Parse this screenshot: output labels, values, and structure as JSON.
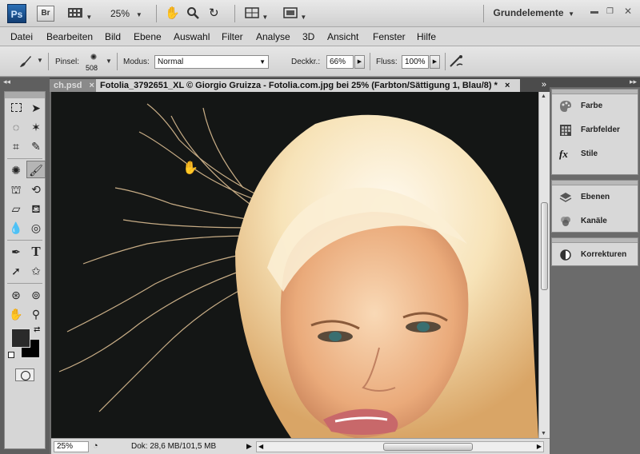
{
  "app": {
    "logo": "Ps",
    "bridge": "Br",
    "zoom": "25%",
    "workspace": "Grundelemente"
  },
  "menu": [
    "Datei",
    "Bearbeiten",
    "Bild",
    "Ebene",
    "Auswahl",
    "Filter",
    "Analyse",
    "3D",
    "Ansicht",
    "Fenster",
    "Hilfe"
  ],
  "options": {
    "brush_label": "Pinsel:",
    "brush_size": "508",
    "mode_label": "Modus:",
    "mode_value": "Normal",
    "opacity_label": "Deckkr.:",
    "opacity_value": "66%",
    "flow_label": "Fluss:",
    "flow_value": "100%"
  },
  "tabs": {
    "inactive": "ch.psd",
    "inactive_close": "×",
    "active": "Fotolia_3792651_XL © Giorgio Gruizza - Fotolia.com.jpg bei 25% (Farbton/Sättigung 1, Blau/8) *",
    "active_close": "×",
    "overflow": "»"
  },
  "status": {
    "zoom": "25%",
    "doc": "Dok: 28,6 MB/101,5 MB"
  },
  "panels": {
    "group1": [
      {
        "label": "Farbe",
        "icon": "color-palette-icon"
      },
      {
        "label": "Farbfelder",
        "icon": "swatches-grid-icon"
      },
      {
        "label": "Stile",
        "icon": "styles-fx-icon"
      }
    ],
    "group2": [
      {
        "label": "Ebenen",
        "icon": "layers-icon"
      },
      {
        "label": "Kanäle",
        "icon": "channels-icon"
      }
    ],
    "group3": [
      {
        "label": "Korrekturen",
        "icon": "adjustments-icon"
      }
    ]
  },
  "colors": {
    "foreground": "#2a2a2a",
    "background": "#000000"
  }
}
